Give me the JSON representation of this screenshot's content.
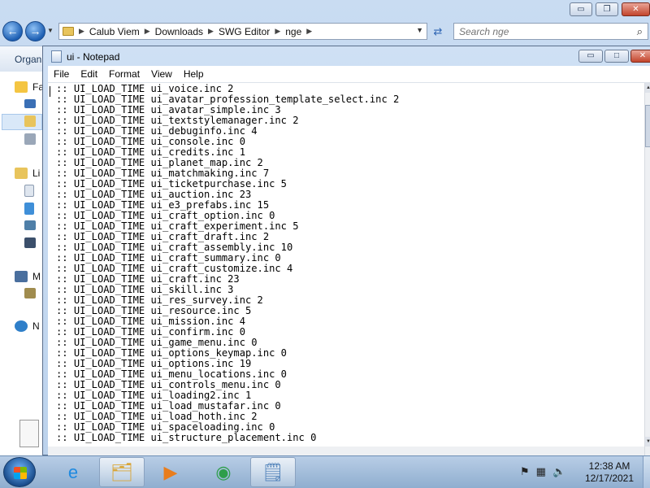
{
  "explorer": {
    "path": [
      "Calub Viem",
      "Downloads",
      "SWG Editor",
      "nge"
    ],
    "search_placeholder": "Search nge",
    "toolbar_label": "Organ",
    "nav_labels": [
      "Fa",
      "Li",
      "M",
      "N"
    ],
    "controls": {
      "minimize": "▭",
      "maximize": "❐",
      "close": "✕"
    }
  },
  "notepad": {
    "title": "ui - Notepad",
    "menu": [
      "File",
      "Edit",
      "Format",
      "View",
      "Help"
    ],
    "controls": {
      "minimize": "▭",
      "maximize": "□",
      "close": "✕"
    },
    "lines": [
      ":: UI_LOAD_TIME ui_voice.inc 2",
      ":: UI_LOAD_TIME ui_avatar_profession_template_select.inc 2",
      ":: UI_LOAD_TIME ui_avatar_simple.inc 3",
      ":: UI_LOAD_TIME ui_textstylemanager.inc 2",
      ":: UI_LOAD_TIME ui_debuginfo.inc 4",
      ":: UI_LOAD_TIME ui_console.inc 0",
      ":: UI_LOAD_TIME ui_credits.inc 1",
      ":: UI_LOAD_TIME ui_planet_map.inc 2",
      ":: UI_LOAD_TIME ui_matchmaking.inc 7",
      ":: UI_LOAD_TIME ui_ticketpurchase.inc 5",
      ":: UI_LOAD_TIME ui_auction.inc 23",
      ":: UI_LOAD_TIME ui_e3_prefabs.inc 15",
      ":: UI_LOAD_TIME ui_craft_option.inc 0",
      ":: UI_LOAD_TIME ui_craft_experiment.inc 5",
      ":: UI_LOAD_TIME ui_craft_draft.inc 2",
      ":: UI_LOAD_TIME ui_craft_assembly.inc 10",
      ":: UI_LOAD_TIME ui_craft_summary.inc 0",
      ":: UI_LOAD_TIME ui_craft_customize.inc 4",
      ":: UI_LOAD_TIME ui_craft.inc 23",
      ":: UI_LOAD_TIME ui_skill.inc 3",
      ":: UI_LOAD_TIME ui_res_survey.inc 2",
      ":: UI_LOAD_TIME ui_resource.inc 5",
      ":: UI_LOAD_TIME ui_mission.inc 4",
      ":: UI_LOAD_TIME ui_confirm.inc 0",
      ":: UI_LOAD_TIME ui_game_menu.inc 0",
      ":: UI_LOAD_TIME ui_options_keymap.inc 0",
      ":: UI_LOAD_TIME ui_options.inc 19",
      ":: UI_LOAD_TIME ui_menu_locations.inc 0",
      ":: UI_LOAD_TIME ui_controls_menu.inc 0",
      ":: UI_LOAD_TIME ui_loading2.inc 1",
      ":: UI_LOAD_TIME ui_load_mustafar.inc 0",
      ":: UI_LOAD_TIME ui_load_hoth.inc 2",
      ":: UI_LOAD_TIME ui_spaceloading.inc 0",
      ":: UI_LOAD_TIME ui_structure_placement.inc 0"
    ]
  },
  "taskbar": {
    "time": "12:38 AM",
    "date": "12/17/2021",
    "apps": [
      {
        "name": "internet-explorer-icon",
        "glyph": "e",
        "color": "#1f8ae0"
      },
      {
        "name": "file-explorer-icon",
        "glyph": "🗂",
        "color": "#d9a63a"
      },
      {
        "name": "media-player-icon",
        "glyph": "▶",
        "color": "#e87d1d"
      },
      {
        "name": "chrome-icon",
        "glyph": "◉",
        "color": "#2e9e4a"
      },
      {
        "name": "notepad-icon",
        "glyph": "🗒",
        "color": "#4d7fb8"
      }
    ]
  }
}
